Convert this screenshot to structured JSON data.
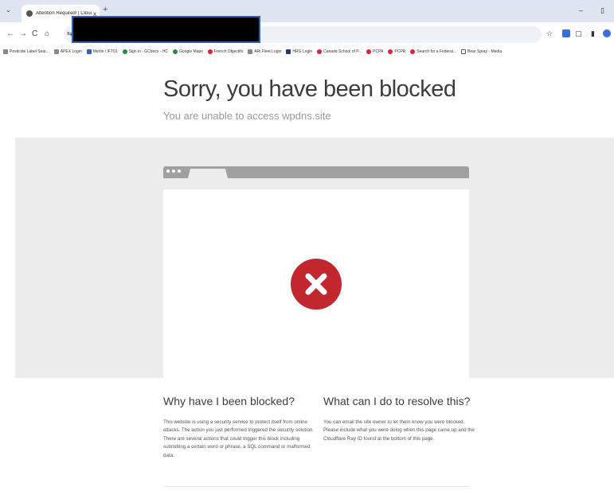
{
  "browser": {
    "tab_title": "Attention Required! | Cloudflare",
    "tab_close": "x",
    "new_tab": "+",
    "tab_menu": "⌄",
    "minimize": "–",
    "restore": "▯",
    "back": "←",
    "forward": "→",
    "reload": "C",
    "home": "⌂",
    "site_info": "⇆",
    "star": "☆",
    "extensions": "▢",
    "sidebar": "▮"
  },
  "bookmarks": [
    {
      "label": "Pesticide Label Sear...",
      "icon": "globe-icon"
    },
    {
      "label": "APEX Login",
      "icon": "page-icon"
    },
    {
      "label": "Merlin / IFT01",
      "icon": "m-icon"
    },
    {
      "label": "Sign in - GCdocs - HC",
      "icon": "gcdocs-icon"
    },
    {
      "label": "Google Maps",
      "icon": "maps-pin-icon"
    },
    {
      "label": "French Objectifs",
      "icon": "maple-leaf-icon"
    },
    {
      "label": "ARi Fleet Login",
      "icon": "ari-icon"
    },
    {
      "label": "HRG Login",
      "icon": "hrg-icon"
    },
    {
      "label": "Canada School of P...",
      "icon": "maple-leaf-icon"
    },
    {
      "label": "PCPA",
      "icon": "maple-leaf-icon"
    },
    {
      "label": "PCPR",
      "icon": "maple-leaf-icon"
    },
    {
      "label": "Search for a Federal...",
      "icon": "maple-leaf-icon"
    },
    {
      "label": "Bear Spray - Media",
      "icon": "folder-icon"
    }
  ],
  "page": {
    "title": "Sorry, you have been blocked",
    "subtitle": "You are unable to access wpdns.site",
    "why": {
      "heading": "Why have I been blocked?",
      "body": "This website is using a security service to protect itself from online attacks. The action you just performed triggered the security solution. There are several actions that could trigger this block including submitting a certain word or phrase, a SQL command or malformed data."
    },
    "resolve": {
      "heading": "What can I do to resolve this?",
      "body": "You can email the site owner to let them know you were blocked. Please include what you were doing when this page came up and the Cloudflare Ray ID found at the bottom of this page."
    }
  },
  "colors": {
    "error_red": "#c1272d",
    "band_grey": "#ececec",
    "window_bar": "#a0a0a0",
    "tabbar": "#dfe5f1"
  }
}
